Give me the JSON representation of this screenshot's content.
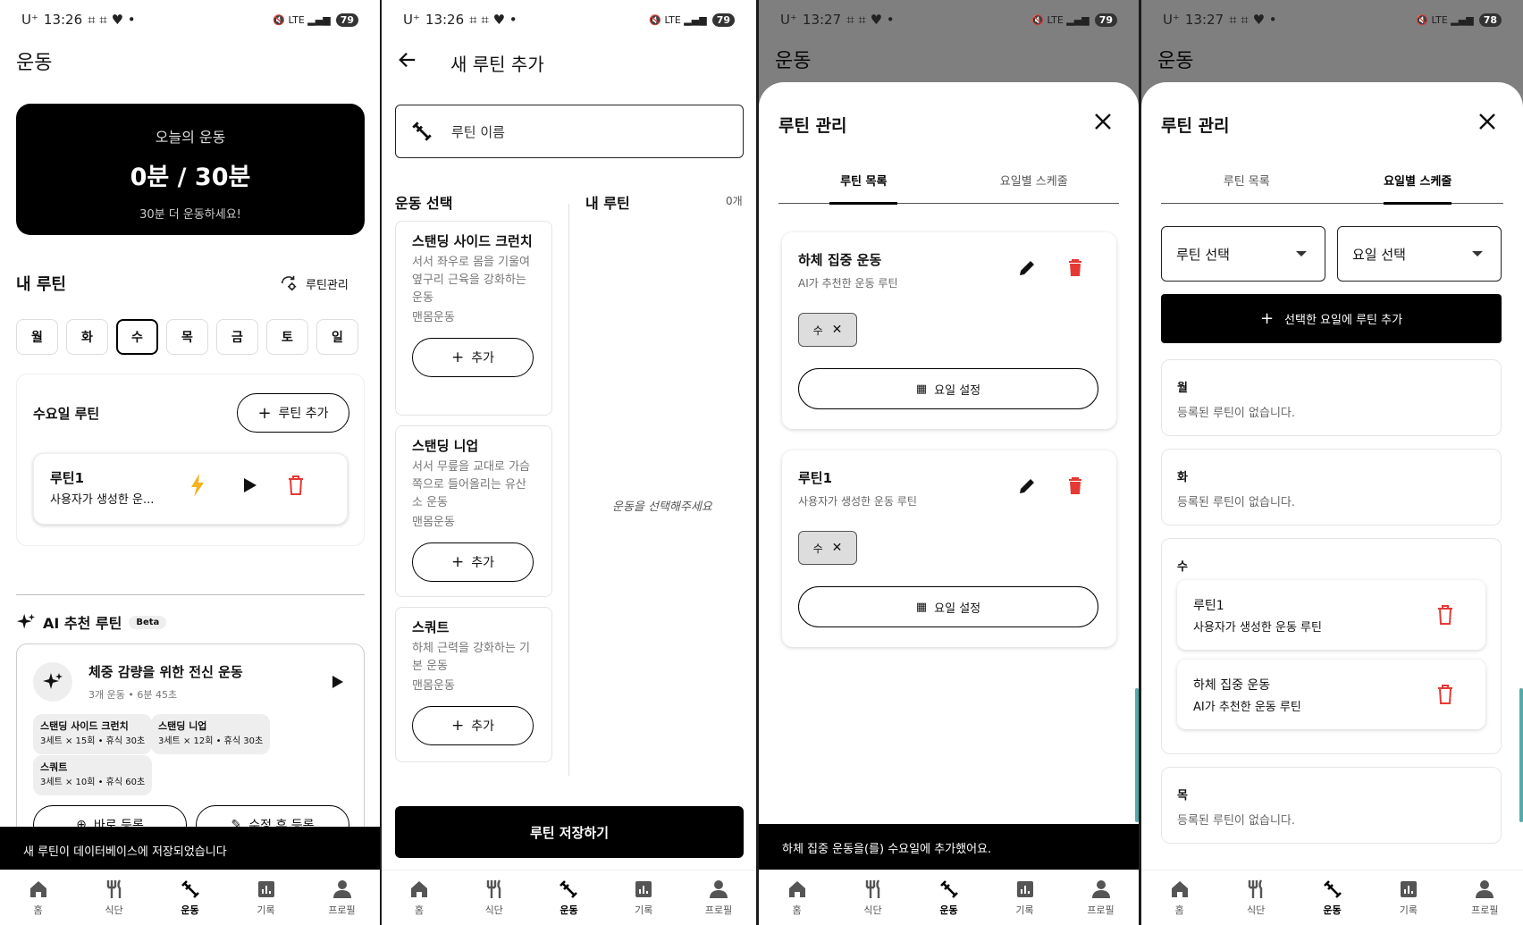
{
  "status": [
    {
      "time": "13:26",
      "battery": "79"
    },
    {
      "time": "13:26",
      "battery": "79"
    },
    {
      "time": "13:27",
      "battery": "79"
    },
    {
      "time": "13:27",
      "battery": "78"
    }
  ],
  "carrier": "U⁺",
  "nav": {
    "home": "홈",
    "diet": "식단",
    "workout": "운동",
    "record": "기록",
    "profile": "프로필"
  },
  "s1": {
    "title": "운동",
    "today_label": "오늘의 운동",
    "today_value": "0분 / 30분",
    "today_note": "30분 더 운동하세요!",
    "my_routine": "내 루틴",
    "manage": "루틴관리",
    "days": [
      "월",
      "화",
      "수",
      "목",
      "금",
      "토",
      "일"
    ],
    "day_routine_title": "수요일 루틴",
    "add_routine": "루틴 추가",
    "routine_name": "루틴1",
    "routine_desc": "사용자가 생성한 운...",
    "ai_title": "AI 추천 루틴",
    "beta": "Beta",
    "ai_card_title": "체중 감량을 위한 전신 운동",
    "ai_card_meta": "3개 운동 • 6분 45초",
    "chips": [
      {
        "name": "스탠딩 사이드 크런치",
        "detail": "3세트 × 15회 • 휴식 30초"
      },
      {
        "name": "스탠딩 니업",
        "detail": "3세트 × 12회 • 휴식 30초"
      },
      {
        "name": "스쿼트",
        "detail": "3세트 × 10회 • 휴식 60초"
      }
    ],
    "btn_register": "바로 등록",
    "btn_edit_register": "수정 후 등록",
    "snackbar": "새 루틴이 데이터베이스에 저장되었습니다"
  },
  "s2": {
    "title": "새 루틴 추가",
    "name_placeholder": "루틴 이름",
    "select_title": "운동 선택",
    "my_routine": "내 루틴",
    "count": "0개",
    "exercises": [
      {
        "name": "스탠딩 사이드 크런치",
        "desc": "서서 좌우로 몸을 기울여 옆구리 근육을 강화하는 운동",
        "tag": "맨몸운동"
      },
      {
        "name": "스탠딩 니업",
        "desc": "서서 무릎을 교대로 가슴 쪽으로 들어올리는 유산소 운동",
        "tag": "맨몸운동"
      },
      {
        "name": "스쿼트",
        "desc": "하체 근력을 강화하는 기본 운동",
        "tag": "맨몸운동"
      }
    ],
    "add": "추가",
    "empty": "운동을 선택해주세요",
    "save": "루틴 저장하기"
  },
  "s3": {
    "bg_title": "운동",
    "sheet_title": "루틴 관리",
    "tab_list": "루틴 목록",
    "tab_schedule": "요일별 스케줄",
    "routines": [
      {
        "name": "하체 집중 운동",
        "desc": "AI가 추천한 운동 루틴",
        "day": "수"
      },
      {
        "name": "루틴1",
        "desc": "사용자가 생성한 운동 루틴",
        "day": "수"
      }
    ],
    "set_day": "요일 설정",
    "snackbar": "하체 집중 운동을(를) 수요일에 추가했어요."
  },
  "s4": {
    "bg_title": "운동",
    "sheet_title": "루틴 관리",
    "tab_list": "루틴 목록",
    "tab_schedule": "요일별 스케줄",
    "routine_select": "루틴 선택",
    "day_select": "요일 선택",
    "add_btn": "선택한 요일에 루틴 추가",
    "empty": "등록된 루틴이 없습니다.",
    "mon": "월",
    "tue": "화",
    "wed": "수",
    "thu": "목",
    "wed_items": [
      {
        "name": "루틴1",
        "desc": "사용자가 생성한 운동 루틴"
      },
      {
        "name": "하체 집중 운동",
        "desc": "AI가 추천한 운동 루틴"
      }
    ]
  }
}
